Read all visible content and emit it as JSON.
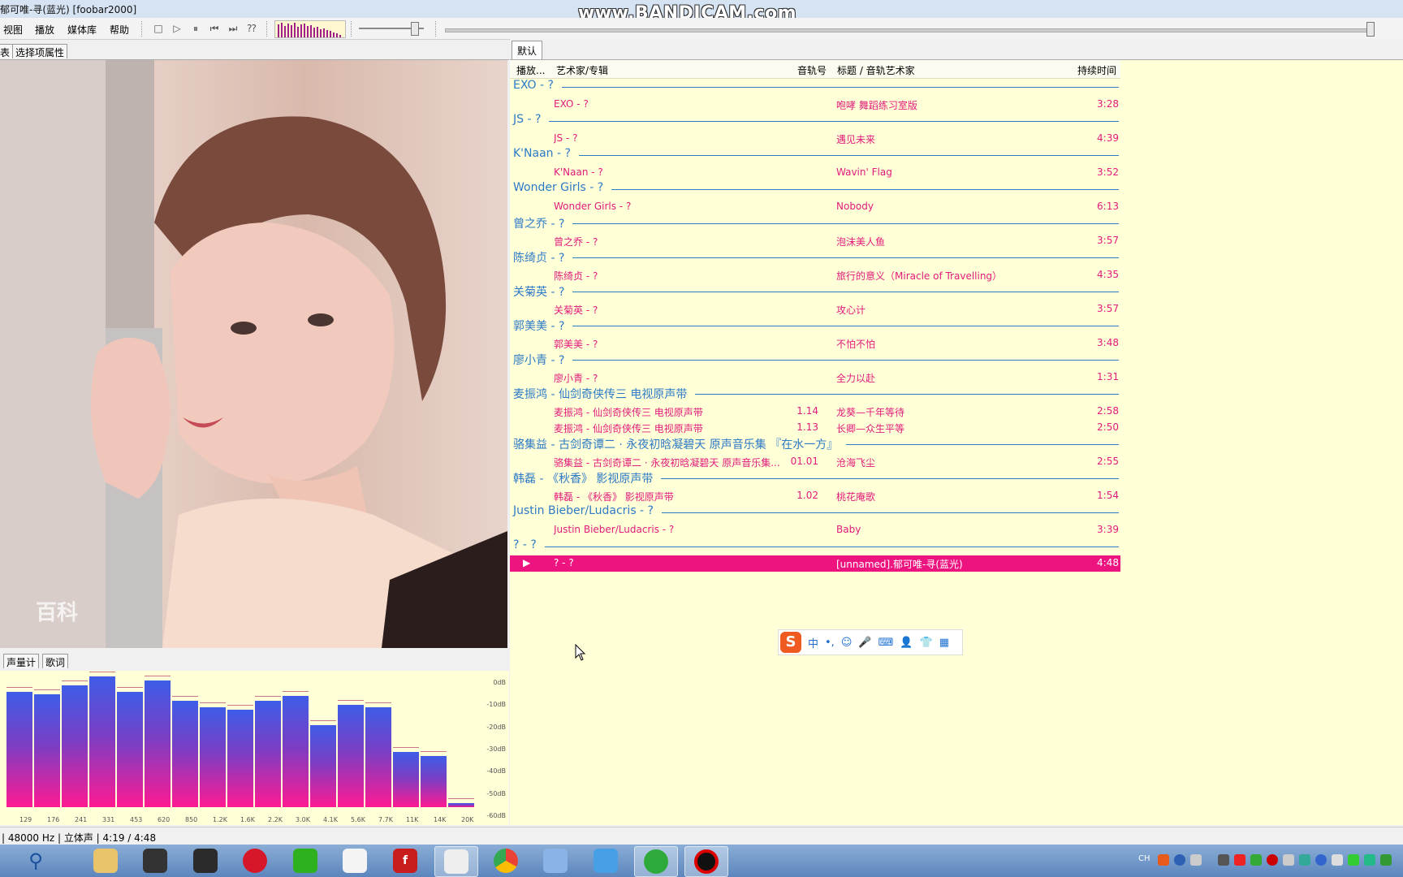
{
  "window": {
    "title": "郁可唯-寻(蓝光)  [foobar2000]",
    "watermark": "www.BANDICAM.com"
  },
  "menu": {
    "view": "视图",
    "playback": "播放",
    "library": "媒体库",
    "help": "帮助"
  },
  "left_tabs": {
    "list": "表",
    "properties": "选择项属性"
  },
  "artwork": {
    "watermark": "百科"
  },
  "vis_tabs": {
    "meter": "声量计",
    "lyrics": "歌词"
  },
  "spectrum": {
    "db_labels": [
      "0dB",
      "-10dB",
      "-20dB",
      "-30dB",
      "-40dB",
      "-50dB",
      "-60dB"
    ],
    "freq_labels": [
      "129",
      "176",
      "241",
      "331",
      "453",
      "620",
      "850",
      "1.2K",
      "1.6K",
      "2.2K",
      "3.0K",
      "4.1K",
      "5.6K",
      "7.7K",
      "11K",
      "14K",
      "20K"
    ],
    "levels_db": [
      -8,
      -9,
      -5,
      -1,
      -8,
      -3,
      -12,
      -15,
      -16,
      -12,
      -10,
      -23,
      -14,
      -15,
      -35,
      -37,
      -58
    ]
  },
  "playlist": {
    "tab": "默认",
    "columns": {
      "playing": "播放...",
      "artist_album": "艺术家/专辑",
      "track_no": "音轨号",
      "title_artist": "标题 / 音轨艺术家",
      "duration": "持续时间"
    },
    "groups": [
      {
        "header": "EXO - ?",
        "tracks": [
          {
            "artist": "EXO - ?",
            "no": "",
            "title": "咆哮 舞蹈练习室版",
            "dur": "3:28"
          }
        ]
      },
      {
        "header": "JS - ?",
        "tracks": [
          {
            "artist": "JS - ?",
            "no": "",
            "title": "遇见未来",
            "dur": "4:39"
          }
        ]
      },
      {
        "header": "K'Naan - ?",
        "tracks": [
          {
            "artist": "K'Naan - ?",
            "no": "",
            "title": "Wavin' Flag",
            "dur": "3:52"
          }
        ]
      },
      {
        "header": "Wonder Girls - ?",
        "tracks": [
          {
            "artist": "Wonder Girls - ?",
            "no": "",
            "title": "Nobody",
            "dur": "6:13"
          }
        ]
      },
      {
        "header": "曾之乔 - ?",
        "tracks": [
          {
            "artist": "曾之乔 - ?",
            "no": "",
            "title": "泡沫美人鱼",
            "dur": "3:57"
          }
        ]
      },
      {
        "header": "陈绮贞 - ?",
        "tracks": [
          {
            "artist": "陈绮贞 - ?",
            "no": "",
            "title": "旅行的意义（Miracle of Travelling）",
            "dur": "4:35"
          }
        ]
      },
      {
        "header": "关菊英 - ?",
        "tracks": [
          {
            "artist": "关菊英 - ?",
            "no": "",
            "title": "攻心计",
            "dur": "3:57"
          }
        ]
      },
      {
        "header": "郭美美 - ?",
        "tracks": [
          {
            "artist": "郭美美 - ?",
            "no": "",
            "title": "不怕不怕",
            "dur": "3:48"
          }
        ]
      },
      {
        "header": "廖小青 - ?",
        "tracks": [
          {
            "artist": "廖小青 - ?",
            "no": "",
            "title": "全力以赴",
            "dur": "1:31"
          }
        ]
      },
      {
        "header": "麦振鸿 - 仙剑奇侠传三 电视原声带",
        "tracks": [
          {
            "artist": "麦振鸿 - 仙剑奇侠传三 电视原声带",
            "no": "1.14",
            "title": "龙葵—千年等待",
            "dur": "2:58"
          },
          {
            "artist": "麦振鸿 - 仙剑奇侠传三 电视原声带",
            "no": "1.13",
            "title": "长卿—众生平等",
            "dur": "2:50"
          }
        ]
      },
      {
        "header": "骆集益 - 古剑奇谭二 · 永夜初晗凝碧天 原声音乐集 『在水一方』",
        "tracks": [
          {
            "artist": "骆集益 - 古剑奇谭二 · 永夜初晗凝碧天 原声音乐集...",
            "no": "01.01",
            "title": "沧海飞尘",
            "dur": "2:55"
          }
        ]
      },
      {
        "header": "韩磊 - 《秋香》 影视原声带",
        "tracks": [
          {
            "artist": "韩磊 - 《秋香》 影视原声带",
            "no": "1.02",
            "title": "桃花庵歌",
            "dur": "1:54"
          }
        ]
      },
      {
        "header": "Justin Bieber/Ludacris - ?",
        "tracks": [
          {
            "artist": "Justin Bieber/Ludacris - ?",
            "no": "",
            "title": "Baby",
            "dur": "3:39"
          }
        ]
      },
      {
        "header": "? - ?",
        "tracks": [
          {
            "artist": "? - ?",
            "no": "",
            "title": "[unnamed].郁可唯-寻(蓝光)",
            "dur": "4:48",
            "playing": true
          }
        ]
      }
    ]
  },
  "ime": {
    "lang": "中"
  },
  "status": {
    "text": "| 48000 Hz | 立体声 | 4:19 / 4:48"
  },
  "tray": {
    "lang": "CH"
  }
}
